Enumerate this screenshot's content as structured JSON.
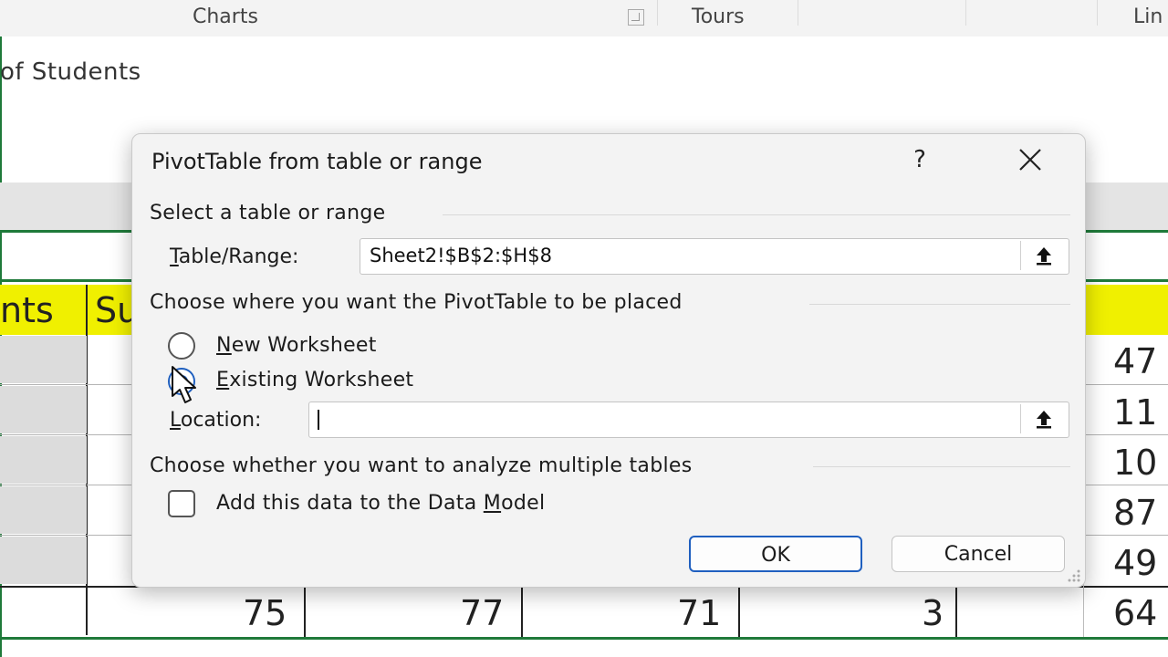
{
  "ribbon": {
    "groups": [
      {
        "label": "Charts"
      },
      {
        "label": "Tours"
      },
      {
        "label": "Lin"
      }
    ]
  },
  "sheet": {
    "title_fragment": "of Students",
    "header_cells": [
      "nts",
      "Su"
    ],
    "right_column_values": [
      "47",
      "11",
      "10",
      "87",
      "49"
    ],
    "bottom_row_values": [
      "75",
      "77",
      "71",
      "3",
      "64"
    ]
  },
  "dialog": {
    "title": "PivotTable from table or range",
    "help_label": "?",
    "section_select": "Select a table or range",
    "table_range_label_prefix": "T",
    "table_range_label_rest": "able/Range:",
    "table_range_value": "Sheet2!$B$2:$H$8",
    "section_place": "Choose where you want the PivotTable to be placed",
    "new_ws_prefix": "N",
    "new_ws_rest": "ew Worksheet",
    "existing_ws_prefix": "E",
    "existing_ws_rest": "xisting Worksheet",
    "location_prefix": "L",
    "location_rest": "ocation:",
    "location_value": "",
    "section_multi": "Choose whether you want to analyze multiple tables",
    "data_model_label_a": "Add this data to the Data ",
    "data_model_label_u": "M",
    "data_model_label_b": "odel",
    "ok_label": "OK",
    "cancel_label": "Cancel",
    "selected_option": "existing_worksheet",
    "data_model_checked": false
  },
  "colors": {
    "accent": "#1f5fbf",
    "header_fill": "#f0f000",
    "grid_green": "#1f7a3a"
  },
  "icons": [
    "question-icon",
    "close-icon",
    "collapse-dialog-icon",
    "mouse-pointer-icon",
    "resize-grip-icon"
  ]
}
